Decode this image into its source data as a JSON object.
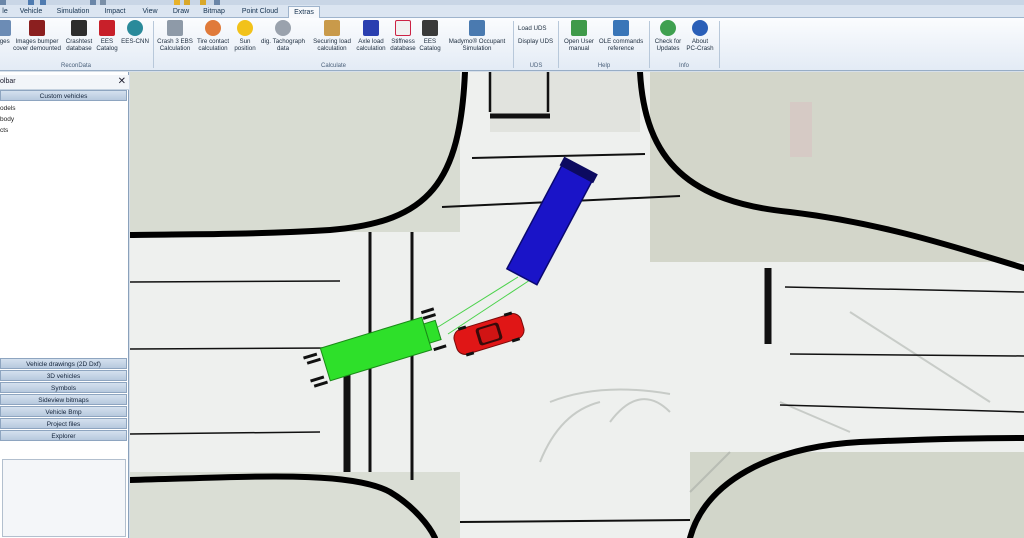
{
  "tabs": [
    "le",
    "Vehicle",
    "Simulation",
    "Impact",
    "View",
    "Draw",
    "Bitmap",
    "Point Cloud",
    "Extras"
  ],
  "active_tab": "Extras",
  "ribbon": {
    "buttons": [
      {
        "label": "ages",
        "icon": "image-icon"
      },
      {
        "label": "Images bumper\ncover demounted",
        "icon": "bumper-icon"
      },
      {
        "label": "Crashtest\ndatabase",
        "icon": "crashtest-icon"
      },
      {
        "label": "EES\nCatalog",
        "icon": "catalog-icon"
      },
      {
        "label": "EES-CNN",
        "icon": "brain-icon"
      },
      {
        "label": "Crash 3 EBS\nCalculation",
        "icon": "calculator-icon"
      },
      {
        "label": "Tire contact\ncalculation",
        "icon": "tire-icon"
      },
      {
        "label": "Sun\nposition",
        "icon": "sun-icon"
      },
      {
        "label": "dig. Tachograph\ndata",
        "icon": "tachograph-icon"
      },
      {
        "label": "Securing load\ncalculation",
        "icon": "load-icon"
      },
      {
        "label": "Axle load\ncalculation",
        "icon": "axle-icon"
      },
      {
        "label": "Stiffness\ndatabase",
        "icon": "chart-icon"
      },
      {
        "label": "EES\nCatalog",
        "icon": "car-catalog-icon"
      },
      {
        "label": "Madymo® Occupant\nSimulation",
        "icon": "occupant-icon"
      },
      {
        "label": "Open User\nmanual",
        "icon": "manual-icon"
      },
      {
        "label": "OLE commands\nreference",
        "icon": "book-icon"
      },
      {
        "label": "Check for\nUpdates",
        "icon": "update-icon"
      },
      {
        "label": "About\nPC-Crash",
        "icon": "info-icon"
      }
    ],
    "uds_load": "Load UDS",
    "uds_display": "Display UDS",
    "groups": [
      "ReconData",
      "Calculate",
      "UDS",
      "Help",
      "Info"
    ]
  },
  "panel": {
    "title": "olbar",
    "close": "✕",
    "top_category": "Custom vehicles",
    "tree_items": [
      "odels",
      "body",
      "cts"
    ],
    "categories": [
      "Vehicle drawings (2D Dxf)",
      "3D vehicles",
      "Symbols",
      "Sideview bitmaps",
      "Vehicle Bmp",
      "Project files",
      "Explorer"
    ]
  },
  "colors": {
    "truck_blue": "#1a14c8",
    "truck_green": "#2ee02a",
    "car_red": "#e01616",
    "tab_active": "#f7f9fc"
  }
}
